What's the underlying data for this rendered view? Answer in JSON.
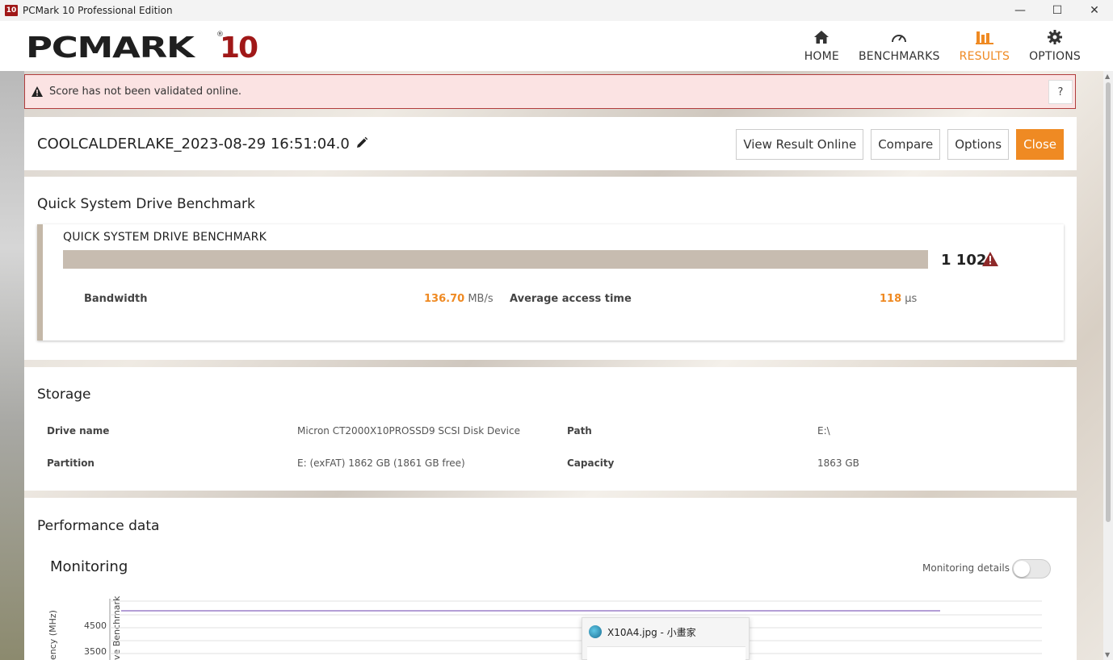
{
  "window": {
    "app_icon": "10",
    "title": "PCMark 10 Professional Edition",
    "minimize": "—",
    "maximize": "☐",
    "close": "✕"
  },
  "logo": {
    "main": "PCMARK",
    "number": "10",
    "reg": "®"
  },
  "nav": [
    {
      "label": "HOME",
      "icon": "home-icon",
      "active": false
    },
    {
      "label": "BENCHMARKS",
      "icon": "gauge-icon",
      "active": false
    },
    {
      "label": "RESULTS",
      "icon": "bar-chart-icon",
      "active": true
    },
    {
      "label": "OPTIONS",
      "icon": "gear-icon",
      "active": false
    }
  ],
  "alert": {
    "message": "Score has not been validated online.",
    "help": "?"
  },
  "result": {
    "name": "COOLCALDERLAKE_2023-08-29 16:51:04.0",
    "buttons": {
      "view_online": "View Result Online",
      "compare": "Compare",
      "options": "Options",
      "close": "Close"
    }
  },
  "benchmark": {
    "heading": "Quick System Drive Benchmark",
    "card_title": "QUICK SYSTEM DRIVE BENCHMARK",
    "score": "1 102",
    "bandwidth_label": "Bandwidth",
    "bandwidth_value": "136.70",
    "bandwidth_unit": "MB/s",
    "access_label": "Average access time",
    "access_value": "118",
    "access_unit": "μs"
  },
  "storage": {
    "heading": "Storage",
    "drive_name_label": "Drive name",
    "drive_name_value": "Micron CT2000X10PROSSD9 SCSI Disk Device",
    "path_label": "Path",
    "path_value": "E:\\",
    "partition_label": "Partition",
    "partition_value": "E: (exFAT) 1862 GB (1861 GB free)",
    "capacity_label": "Capacity",
    "capacity_value": "1863 GB"
  },
  "performance": {
    "heading": "Performance data",
    "monitoring": "Monitoring",
    "monitoring_details": "Monitoring details",
    "monitoring_details_on": false
  },
  "chart_data": {
    "type": "line",
    "ylabel": "ency (MHz)",
    "series_label": "ve Benchmark",
    "y_ticks": [
      "4500",
      "3500"
    ]
  },
  "popup": {
    "title": "X10A4.jpg - 小畫家"
  },
  "colors": {
    "accent": "#ef8a23",
    "brand_red": "#a01818",
    "alert_border": "#b13c3c",
    "score_bar": "#c7bcb0"
  }
}
